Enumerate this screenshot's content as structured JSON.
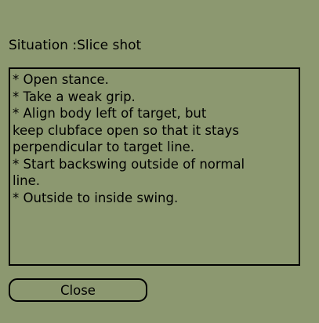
{
  "dialog": {
    "title": "Situation :Slice shot",
    "lines": [
      "* Open stance.",
      "* Take a weak grip.",
      "* Align body left of target, but",
      "keep clubface open so that it stays",
      "perpendicular to target line.",
      "* Start backswing outside of normal",
      "line.",
      "* Outside to inside swing."
    ],
    "close_label": "Close"
  }
}
